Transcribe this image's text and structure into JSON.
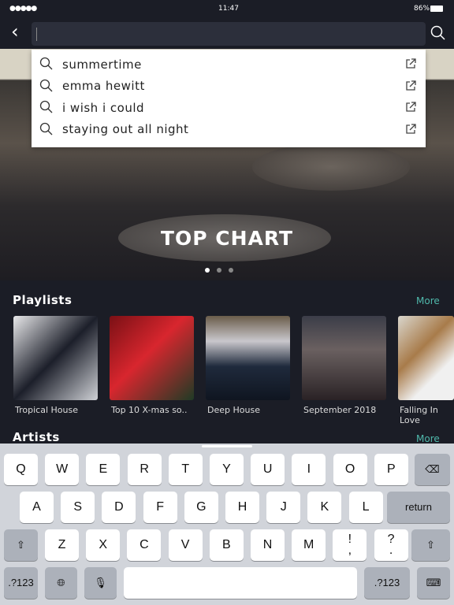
{
  "status": {
    "time": "11:47",
    "battery": "86%",
    "signal": "●●●●●"
  },
  "nav": {
    "search_value": "",
    "search_placeholder": ""
  },
  "suggestions": [
    "summertime",
    "emma hewitt",
    "i wish i could",
    "staying out all night"
  ],
  "banner": {
    "title": "TOP CHART",
    "page_count": 3,
    "active_page": 1
  },
  "playlists": {
    "title": "Playlists",
    "more": "More",
    "items": [
      {
        "name": "Tropical House"
      },
      {
        "name": "Top 10 X-mas so.."
      },
      {
        "name": "Deep House"
      },
      {
        "name": "September 2018"
      },
      {
        "name": "Falling In Love"
      }
    ]
  },
  "artists": {
    "title": "Artists",
    "more": "More"
  },
  "keyboard": {
    "row1": [
      "Q",
      "W",
      "E",
      "R",
      "T",
      "Y",
      "U",
      "I",
      "O",
      "P"
    ],
    "row2": [
      "A",
      "S",
      "D",
      "F",
      "G",
      "H",
      "J",
      "K",
      "L"
    ],
    "return": "return",
    "row3": [
      "Z",
      "X",
      "C",
      "V",
      "B",
      "N",
      "M",
      "!\n,",
      "?\n."
    ],
    "numbers": ".?123"
  },
  "colors": {
    "accent": "#4fb8ab",
    "background": "#1b1d26"
  }
}
